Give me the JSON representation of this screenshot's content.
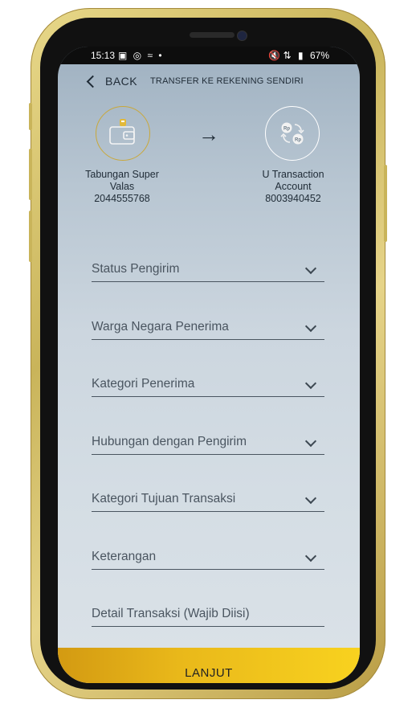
{
  "statusbar": {
    "time": "15:13",
    "left_icons": "▣ ◎ ≈ •",
    "right_icons": "🔇 ⇅",
    "battery": "67%"
  },
  "header": {
    "back_label": "BACK",
    "title": "TRANSFER KE REKENING SENDIRI"
  },
  "source_account": {
    "name_line1": "Tabungan Super",
    "name_line2": "Valas",
    "number": "2044555768",
    "icon": "wallet-icon"
  },
  "dest_account": {
    "name_line1": "U Transaction",
    "name_line2": "Account",
    "number": "8003940452",
    "icon": "currency-exchange-icon"
  },
  "fields": [
    {
      "label": "Status Pengirim"
    },
    {
      "label": "Warga Negara Penerima"
    },
    {
      "label": "Kategori Penerima"
    },
    {
      "label": "Hubungan dengan Pengirim"
    },
    {
      "label": "Kategori Tujuan Transaksi"
    },
    {
      "label": "Keterangan"
    },
    {
      "label": "Detail Transaksi (Wajib Diisi)"
    }
  ],
  "submit_label": "LANJUT",
  "colors": {
    "accent_gold": "#e9b81a",
    "text_dark": "#1f2b36",
    "field_text": "#4a5560"
  }
}
